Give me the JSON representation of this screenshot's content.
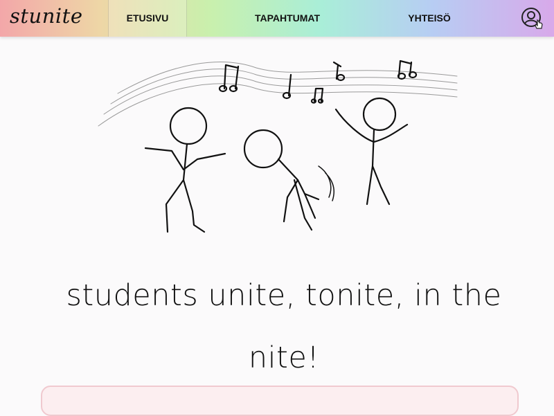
{
  "app": {
    "logo": "stunite"
  },
  "nav": {
    "items": [
      {
        "label": "ETUSIVU",
        "active": true
      },
      {
        "label": "TAPAHTUMAT",
        "active": false
      },
      {
        "label": "YHTEISÖ",
        "active": false
      }
    ],
    "user_icon": "user-circle-icon"
  },
  "hero": {
    "illustration": "dancing-stick-figures-music-notes",
    "headline": "students unite, tonite, in the nite!"
  },
  "colors": {
    "nav_gradient": [
      "#f3a7a9",
      "#eed6a6",
      "#c9f0ad",
      "#a9eed8",
      "#b7cdf3",
      "#d8a9ea"
    ],
    "card_border": "#f0c9cf",
    "card_background": "#fceef0"
  }
}
